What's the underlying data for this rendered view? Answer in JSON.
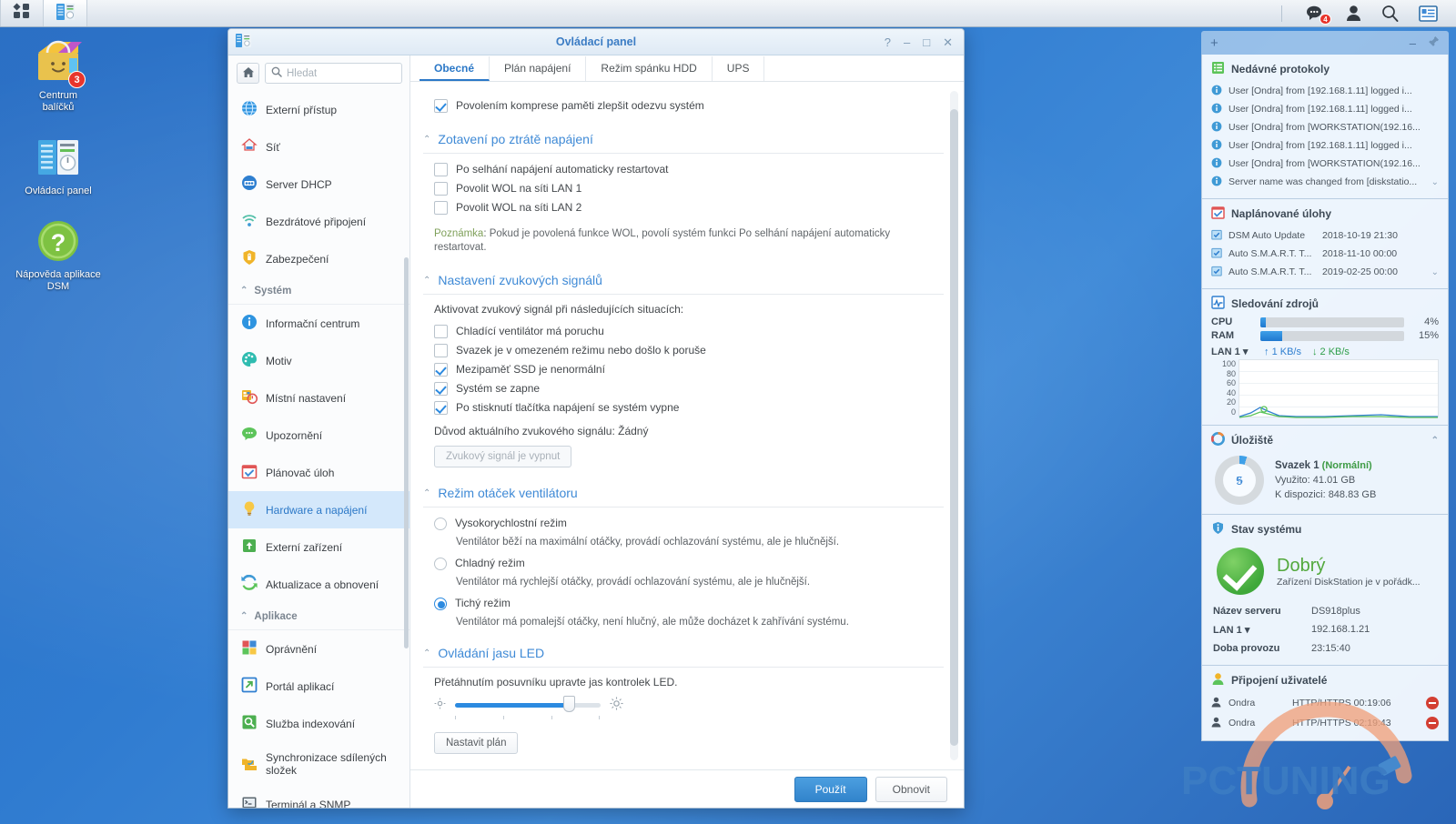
{
  "taskbar": {
    "left_buttons": [
      {
        "name": "apps-menu",
        "icon": "grid-icon"
      },
      {
        "name": "control-panel-task",
        "icon": "control-panel-icon",
        "active": true
      }
    ],
    "right_icons": [
      {
        "name": "notifications-icon",
        "badge": "4"
      },
      {
        "name": "user-account-icon",
        "badge": ""
      },
      {
        "name": "search-icon",
        "badge": ""
      },
      {
        "name": "widgets-icon",
        "badge": ""
      }
    ]
  },
  "desktop_icons": [
    {
      "label": "Centrum\nbalíčků",
      "label_line1": "Centrum",
      "label_line2": "balíčků",
      "badge": "3",
      "icon": "package-center-icon"
    },
    {
      "label": "Ovládací panel",
      "label_line1": "Ovládací panel",
      "label_line2": "",
      "badge": "",
      "icon": "control-panel-icon"
    },
    {
      "label": "Nápověda aplikace DSM",
      "label_line1": "Nápověda aplikace",
      "label_line2": "DSM",
      "badge": "",
      "icon": "help-icon"
    }
  ],
  "window": {
    "title": "Ovládací panel",
    "buttons": {
      "help": "?",
      "minimize": "–",
      "maximize": "□",
      "close": "✕"
    }
  },
  "sidebar": {
    "home_button": "home-icon",
    "search_placeholder": "Hledat",
    "search_value": "",
    "items": [
      {
        "type": "item",
        "label": "Externí přístup",
        "icon": "globe-icon",
        "selected": false
      },
      {
        "type": "item",
        "label": "Síť",
        "icon": "network-icon",
        "selected": false
      },
      {
        "type": "item",
        "label": "Server DHCP",
        "icon": "dhcp-icon",
        "selected": false
      },
      {
        "type": "item",
        "label": "Bezdrátové připojení",
        "icon": "wifi-icon",
        "selected": false
      },
      {
        "type": "item",
        "label": "Zabezpečení",
        "icon": "shield-icon",
        "selected": false
      },
      {
        "type": "group",
        "label": "Systém"
      },
      {
        "type": "item",
        "label": "Informační centrum",
        "icon": "info-icon",
        "selected": false
      },
      {
        "type": "item",
        "label": "Motiv",
        "icon": "palette-icon",
        "selected": false
      },
      {
        "type": "item",
        "label": "Místní nastavení",
        "icon": "regional-icon",
        "selected": false
      },
      {
        "type": "item",
        "label": "Upozornění",
        "icon": "notification-icon",
        "selected": false
      },
      {
        "type": "item",
        "label": "Plánovač úloh",
        "icon": "calendar-icon",
        "selected": false
      },
      {
        "type": "item",
        "label": "Hardware a napájení",
        "icon": "bulb-icon",
        "selected": true
      },
      {
        "type": "item",
        "label": "Externí zařízení",
        "icon": "external-device-icon",
        "selected": false
      },
      {
        "type": "item",
        "label": "Aktualizace a obnovení",
        "icon": "update-icon",
        "selected": false
      },
      {
        "type": "group",
        "label": "Aplikace"
      },
      {
        "type": "item",
        "label": "Oprávnění",
        "icon": "permissions-icon",
        "selected": false
      },
      {
        "type": "item",
        "label": "Portál aplikací",
        "icon": "app-portal-icon",
        "selected": false
      },
      {
        "type": "item",
        "label": "Služba indexování",
        "icon": "indexing-icon",
        "selected": false
      },
      {
        "type": "item",
        "label": "Synchronizace sdílených složek",
        "label2": "složek",
        "label1": "Synchronizace sdílených",
        "icon": "folder-sync-icon",
        "selected": false,
        "two_line": true
      },
      {
        "type": "item",
        "label": "Terminál a SNMP",
        "icon": "terminal-icon",
        "selected": false
      }
    ]
  },
  "tabs": [
    {
      "label": "Obecné",
      "active": true
    },
    {
      "label": "Plán napájení",
      "active": false
    },
    {
      "label": "Režim spánku HDD",
      "active": false
    },
    {
      "label": "UPS",
      "active": false
    }
  ],
  "main": {
    "memory_compression": {
      "label": "Povolením komprese paměti zlepšit odezvu systém",
      "checked": true
    },
    "power_recovery": {
      "heading": "Zotavení po ztrátě napájení",
      "options": [
        {
          "label": "Po selhání napájení automaticky restartovat",
          "checked": false
        },
        {
          "label": "Povolit WOL na síti LAN 1",
          "checked": false
        },
        {
          "label": "Povolit WOL na síti LAN 2",
          "checked": false
        }
      ],
      "note_label": "Poznámka",
      "note_text": ": Pokud je povolená funkce WOL, povolí systém funkci Po selhání napájení automaticky restartovat."
    },
    "beep": {
      "heading": "Nastavení zvukových signálů",
      "intro": "Aktivovat zvukový signál při následujících situacích:",
      "options": [
        {
          "label": "Chladící ventilátor má poruchu",
          "checked": false
        },
        {
          "label": "Svazek je v omezeném režimu nebo došlo k poruše",
          "checked": false
        },
        {
          "label": "Mezipaměť SSD je nenormální",
          "checked": true
        },
        {
          "label": "Systém se zapne",
          "checked": true
        },
        {
          "label": "Po stisknutí tlačítka napájení se systém vypne",
          "checked": true
        }
      ],
      "reason_text": "Důvod aktuálního zvukového signálu: Žádný",
      "button_label": "Zvukový signál je vypnut",
      "button_disabled": true
    },
    "fan": {
      "heading": "Režim otáček ventilátoru",
      "options": [
        {
          "label": "Vysokorychlostní režim",
          "desc": "Ventilátor běží na maximální otáčky, provádí ochlazování systému, ale je hlučnější.",
          "selected": false
        },
        {
          "label": "Chladný režim",
          "desc": "Ventilátor má rychlejší otáčky, provádí ochlazování systému, ale je hlučnější.",
          "selected": false
        },
        {
          "label": "Tichý režim",
          "desc": "Ventilátor má pomalejší otáčky, není hlučný, ale může docházet k zahřívání systému.",
          "selected": true
        }
      ]
    },
    "led": {
      "heading": "Ovládání jasu LED",
      "desc": "Přetáhnutím posuvníku upravte jas kontrolek LED.",
      "slider_value": 75,
      "schedule_button": "Nastavit plán"
    },
    "footer": {
      "apply": "Použít",
      "reset": "Obnovit"
    }
  },
  "widgets": {
    "header": {
      "add": "+",
      "minimize": "–",
      "pin": "pin-icon"
    },
    "logs": {
      "title": "Nedávné protokoly",
      "items": [
        "User [Ondra] from [192.168.1.11] logged i...",
        "User [Ondra] from [192.168.1.11] logged i...",
        "User [Ondra] from [WORKSTATION(192.16...",
        "User [Ondra] from [192.168.1.11] logged i...",
        "User [Ondra] from [WORKSTATION(192.16...",
        "Server name was changed from [diskstatio..."
      ]
    },
    "tasks": {
      "title": "Naplánované úlohy",
      "items": [
        {
          "name": "DSM Auto Update",
          "time": "2018-10-19 21:30"
        },
        {
          "name": "Auto S.M.A.R.T. T...",
          "time": "2018-11-10 00:00"
        },
        {
          "name": "Auto S.M.A.R.T. T...",
          "time": "2019-02-25 00:00"
        }
      ]
    },
    "resources": {
      "title": "Sledování zdrojů",
      "cpu_label": "CPU",
      "cpu_value": "4%",
      "cpu_percent": 4,
      "ram_label": "RAM",
      "ram_value": "15%",
      "ram_percent": 15,
      "lan_label": "LAN 1",
      "upload": "1 KB/s",
      "download": "2 KB/s",
      "axis_ticks": [
        "100",
        "80",
        "60",
        "40",
        "20",
        "0"
      ]
    },
    "storage": {
      "title": "Úložiště",
      "percent_value": "5",
      "percent_unit": "%",
      "volume_name": "Svazek 1",
      "volume_status": "(Normální)",
      "used": "Využito: 41.01 GB",
      "available": "K dispozici: 848.83 GB"
    },
    "system": {
      "title": "Stav systému",
      "status": "Dobrý",
      "status_desc": "Zařízení DiskStation je v pořádk...",
      "rows": [
        {
          "key": "Název serveru",
          "value": "DS918plus"
        },
        {
          "key": "LAN 1",
          "value": "192.168.1.21"
        },
        {
          "key": "Doba provozu",
          "value": "23:15:40"
        }
      ]
    },
    "users": {
      "title": "Připojení uživatelé",
      "items": [
        {
          "name": "Ondra",
          "conn": "HTTP/HTTPS 00:19:06"
        },
        {
          "name": "Ondra",
          "conn": "HTTP/HTTPS 02:19:43"
        }
      ]
    }
  },
  "watermark": {
    "text": "PCTUNING"
  },
  "colors": {
    "accent": "#2b78c7",
    "link": "#3f8ad6",
    "good": "#52a83c",
    "desktop": "#2f7bd0"
  }
}
